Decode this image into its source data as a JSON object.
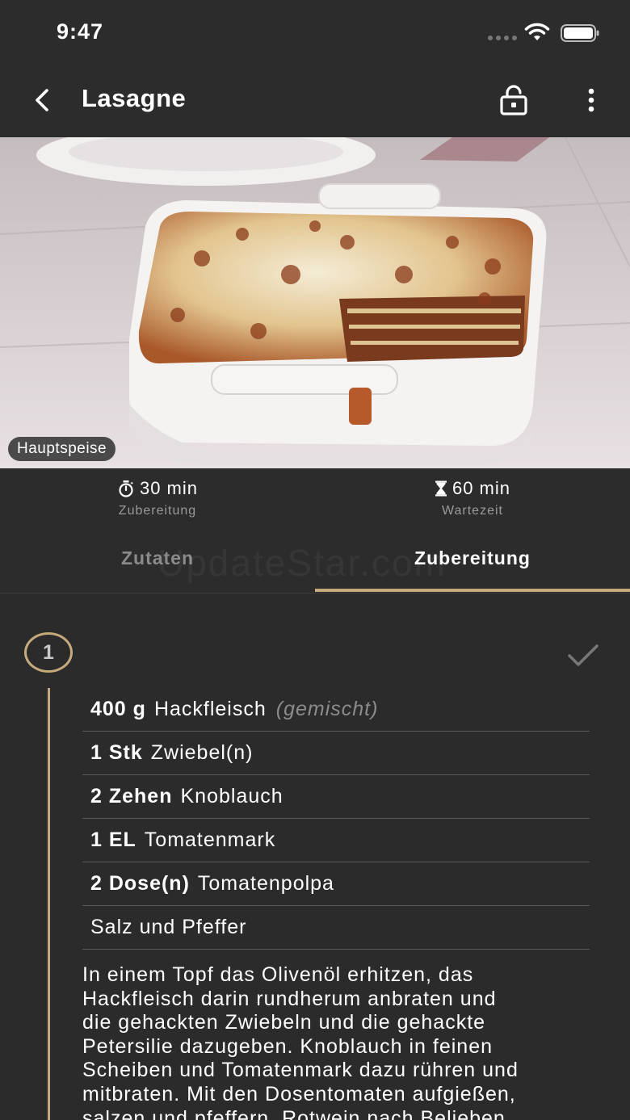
{
  "status_bar": {
    "time": "9:47"
  },
  "header": {
    "title": "Lasagne"
  },
  "hero": {
    "category": "Hauptspeise"
  },
  "times": [
    {
      "value": "30 min",
      "label": "Zubereitung",
      "icon": "stopwatch-icon"
    },
    {
      "value": "60 min",
      "label": "Wartezeit",
      "icon": "hourglass-icon"
    }
  ],
  "tabs": [
    {
      "label": "Zutaten",
      "active": false
    },
    {
      "label": "Zubereitung",
      "active": true
    }
  ],
  "watermark": "UpdateStar.com",
  "step": {
    "number": "1",
    "ingredients": [
      {
        "qty": "400 g",
        "name": "Hackfleisch",
        "note": "(gemischt)"
      },
      {
        "qty": "1 Stk",
        "name": "Zwiebel(n)",
        "note": ""
      },
      {
        "qty": "2 Zehen",
        "name": "Knoblauch",
        "note": ""
      },
      {
        "qty": "1 EL",
        "name": "Tomatenmark",
        "note": ""
      },
      {
        "qty": "2 Dose(n)",
        "name": "Tomatenpolpa",
        "note": ""
      },
      {
        "qty": "",
        "name": "Salz und Pfeffer",
        "note": ""
      }
    ],
    "instruction_lines": [
      "In einem Topf das Olivenöl erhitzen, das",
      "Hackfleisch darin rundherum anbraten und",
      "die gehackten Zwiebeln und die gehackte",
      "Petersilie dazugeben. Knoblauch in feinen",
      "Scheiben und Tomatenmark dazu rühren und",
      "mitbraten. Mit den Dosentomaten aufgießen,",
      "salzen und pfeffern. Rotwein nach Belieben"
    ]
  },
  "colors": {
    "accent": "#c5ab7b",
    "background": "#2b2b2b",
    "bar": "#2c2c2c"
  }
}
